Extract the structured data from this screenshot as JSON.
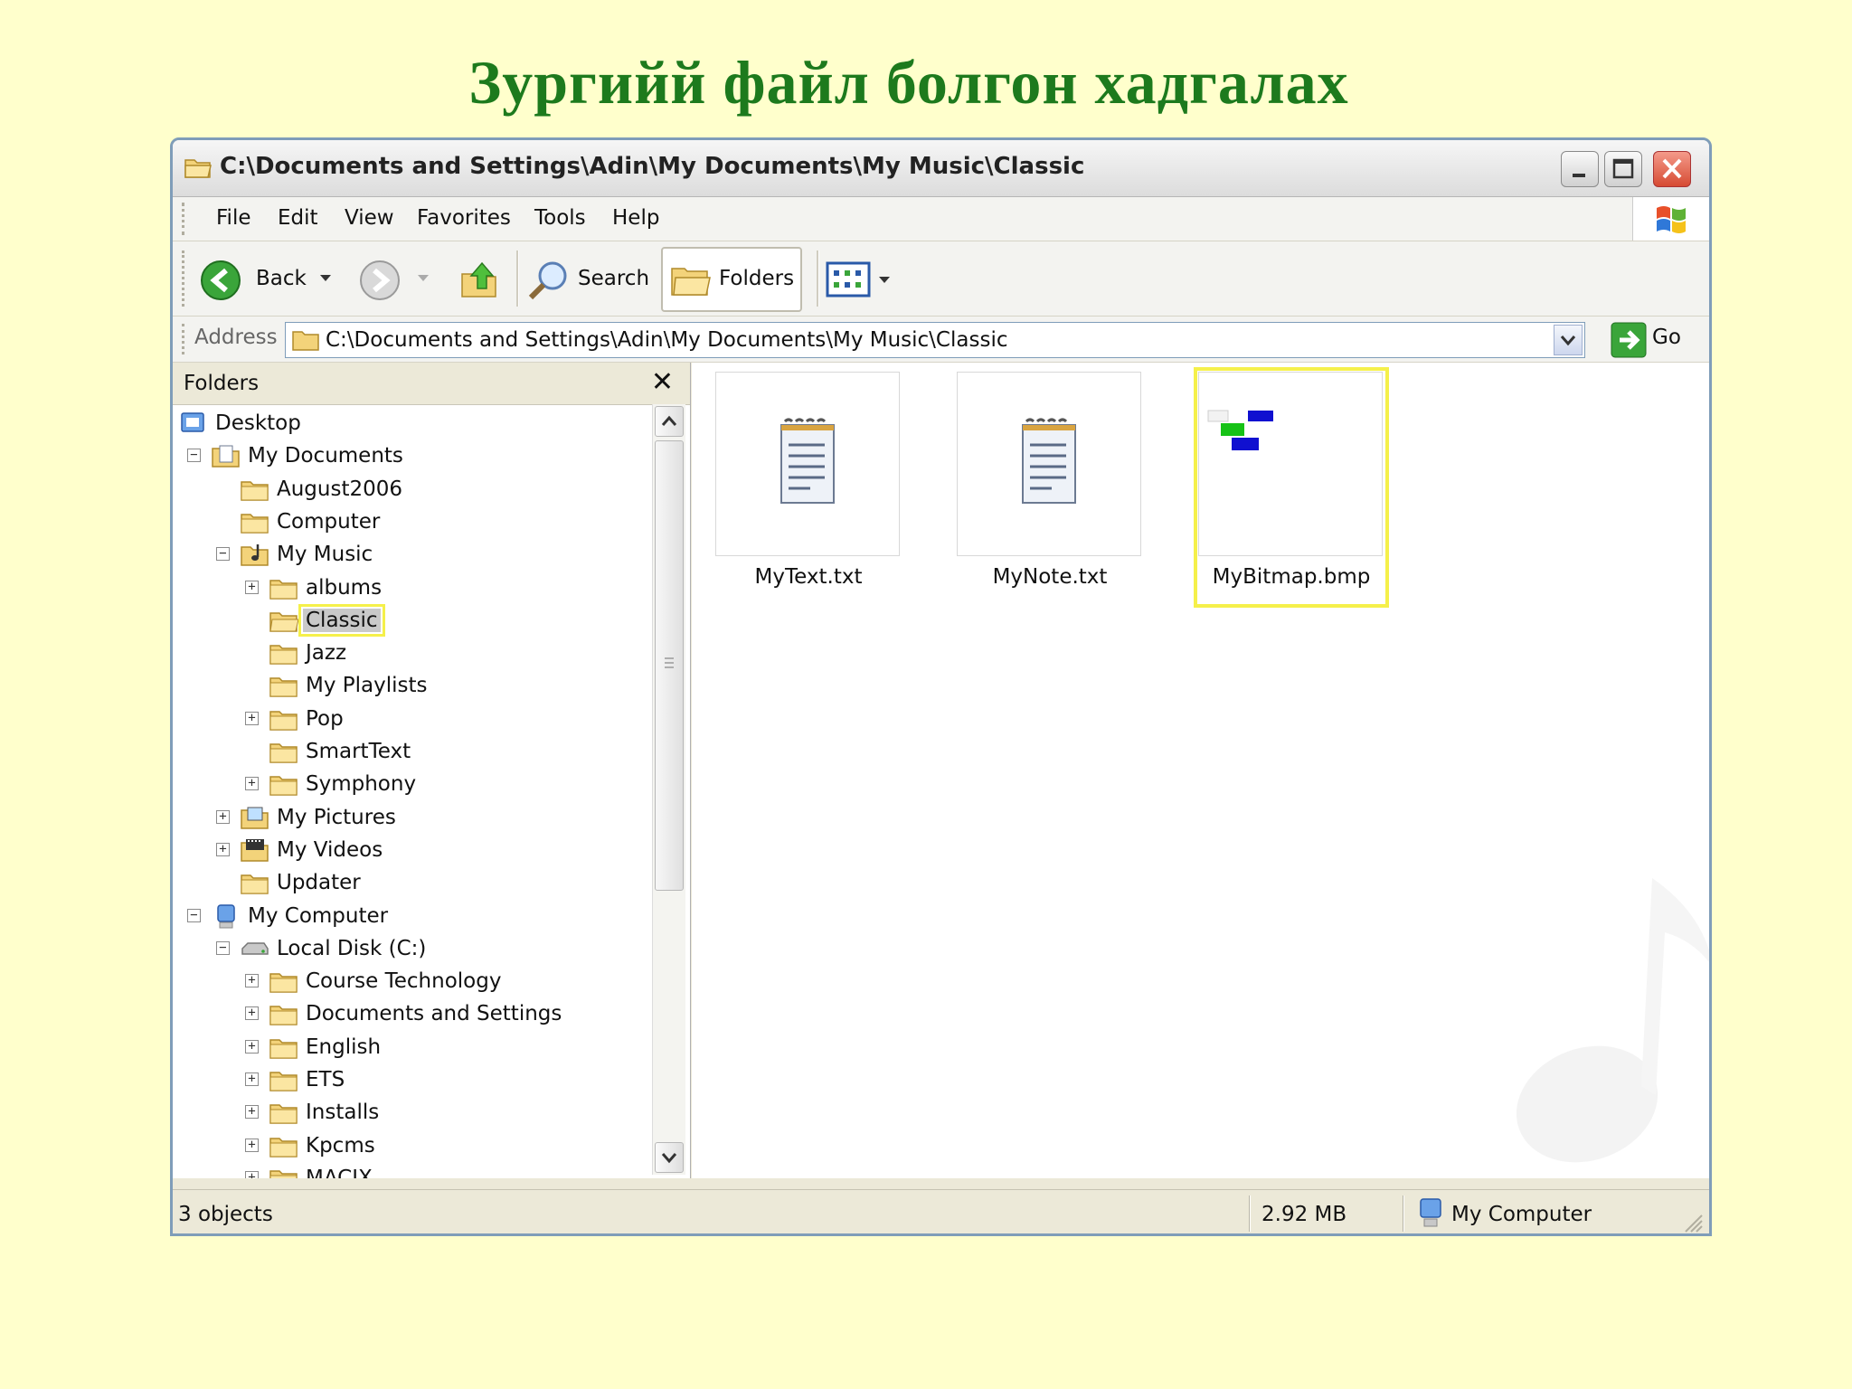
{
  "slide": {
    "title": "Зургийй файл болгон хадгалах"
  },
  "window": {
    "title": "C:\\Documents and Settings\\Adin\\My Documents\\My Music\\Classic"
  },
  "menu": [
    "File",
    "Edit",
    "View",
    "Favorites",
    "Tools",
    "Help"
  ],
  "toolbar": {
    "back_label": "Back",
    "search_label": "Search",
    "folders_label": "Folders"
  },
  "address": {
    "label": "Address",
    "value": "C:\\Documents and Settings\\Adin\\My Documents\\My Music\\Classic",
    "go_label": "Go"
  },
  "folders_pane": {
    "title": "Folders",
    "close_glyph": "✕",
    "tree": [
      {
        "label": "Desktop",
        "icon": "desktop-icon",
        "level": 0,
        "toggle": ""
      },
      {
        "label": "My Documents",
        "icon": "my-documents-icon",
        "level": 1,
        "toggle": "−"
      },
      {
        "label": "August2006",
        "icon": "folder-icon",
        "level": 2,
        "toggle": ""
      },
      {
        "label": "Computer",
        "icon": "folder-icon",
        "level": 2,
        "toggle": ""
      },
      {
        "label": "My Music",
        "icon": "my-music-icon",
        "level": 2,
        "toggle": "−"
      },
      {
        "label": "albums",
        "icon": "folder-icon",
        "level": 3,
        "toggle": "+"
      },
      {
        "label": "Classic",
        "icon": "folder-open-icon",
        "level": 3,
        "toggle": "",
        "selected": true
      },
      {
        "label": "Jazz",
        "icon": "folder-icon",
        "level": 3,
        "toggle": ""
      },
      {
        "label": "My Playlists",
        "icon": "folder-icon",
        "level": 3,
        "toggle": ""
      },
      {
        "label": "Pop",
        "icon": "folder-icon",
        "level": 3,
        "toggle": "+"
      },
      {
        "label": "SmartText",
        "icon": "folder-icon",
        "level": 3,
        "toggle": ""
      },
      {
        "label": "Symphony",
        "icon": "folder-icon",
        "level": 3,
        "toggle": "+"
      },
      {
        "label": "My Pictures",
        "icon": "my-pictures-icon",
        "level": 2,
        "toggle": "+"
      },
      {
        "label": "My Videos",
        "icon": "my-videos-icon",
        "level": 2,
        "toggle": "+"
      },
      {
        "label": "Updater",
        "icon": "folder-icon",
        "level": 2,
        "toggle": ""
      },
      {
        "label": "My Computer",
        "icon": "my-computer-icon",
        "level": 1,
        "toggle": "−"
      },
      {
        "label": "Local Disk (C:)",
        "icon": "local-disk-icon",
        "level": 2,
        "toggle": "−"
      },
      {
        "label": "Course Technology",
        "icon": "folder-icon",
        "level": 3,
        "toggle": "+"
      },
      {
        "label": "Documents and Settings",
        "icon": "folder-icon",
        "level": 3,
        "toggle": "+"
      },
      {
        "label": "English",
        "icon": "folder-icon",
        "level": 3,
        "toggle": "+"
      },
      {
        "label": "ETS",
        "icon": "folder-icon",
        "level": 3,
        "toggle": "+"
      },
      {
        "label": "Installs",
        "icon": "folder-icon",
        "level": 3,
        "toggle": "+"
      },
      {
        "label": "Kpcms",
        "icon": "folder-icon",
        "level": 3,
        "toggle": "+"
      },
      {
        "label": "MACIX",
        "icon": "folder-icon",
        "level": 3,
        "toggle": "+"
      }
    ]
  },
  "files": [
    {
      "name": "MyText.txt",
      "icon": "notepad-file-icon"
    },
    {
      "name": "MyNote.txt",
      "icon": "notepad-file-icon"
    },
    {
      "name": "MyBitmap.bmp",
      "icon": "bitmap-thumbnail-icon",
      "highlighted": true
    }
  ],
  "status": {
    "objects": "3 objects",
    "size": "2.92 MB",
    "location": "My Computer"
  },
  "colors": {
    "slide_bg": "#ffffcc",
    "title_green": "#1d7a1d",
    "highlight_yellow": "#f5f04a"
  }
}
